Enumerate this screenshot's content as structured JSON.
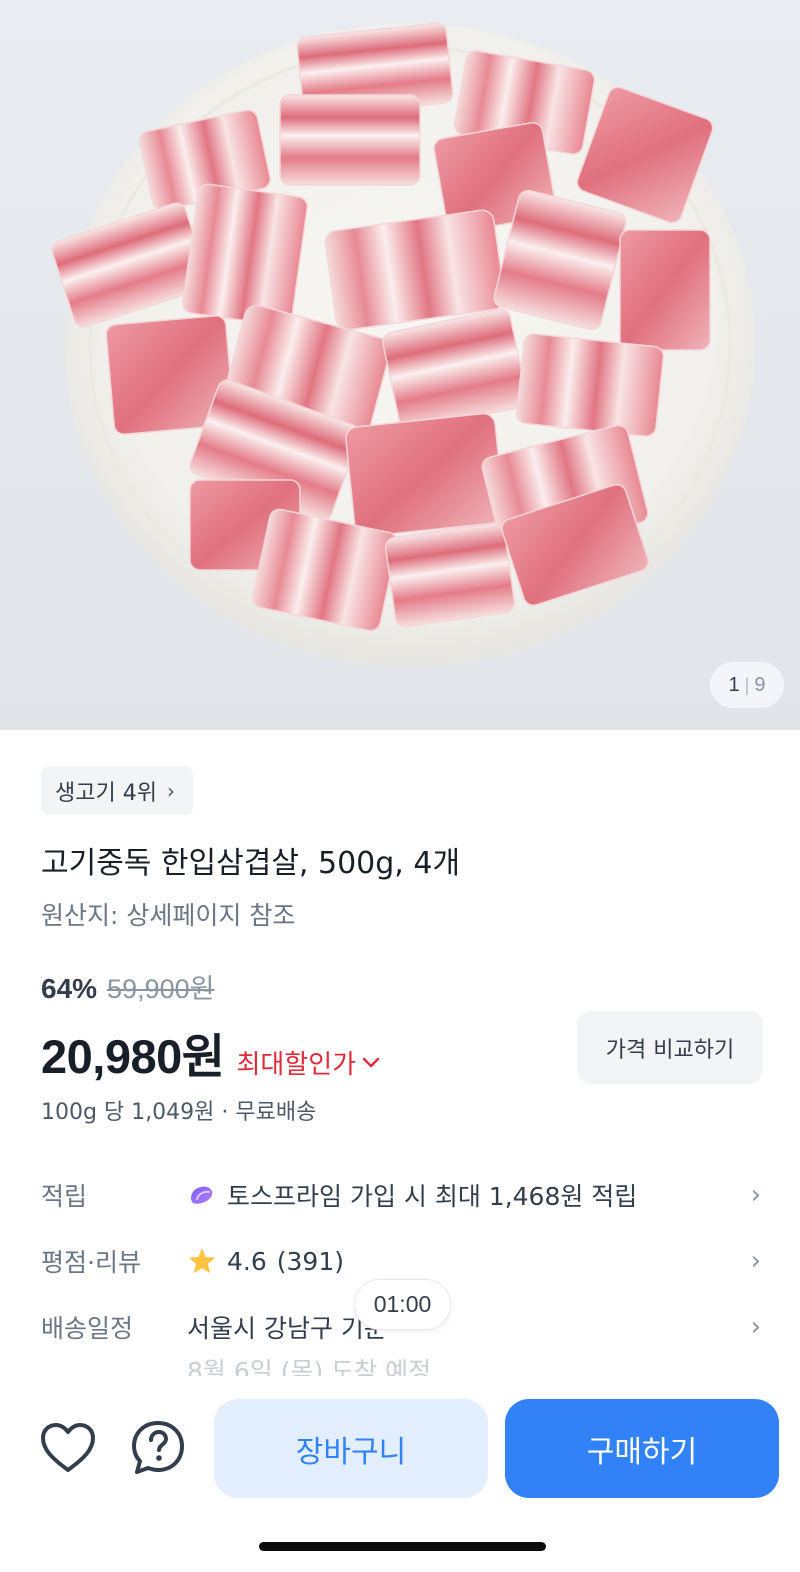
{
  "hero": {
    "image_alt": "한입삼겹살",
    "counter_current": "1",
    "counter_total": "9"
  },
  "product": {
    "rank_chip": "생고기 4위",
    "title": "고기중독 한입삼겹살, 500g, 4개",
    "origin": "원산지: 상세페이지 참조",
    "discount_rate": "64%",
    "original_price": "59,900원",
    "price": "20,980원",
    "max_discount_label": "최대할인가",
    "compare_button": "가격 비교하기",
    "unit_price": "100g 당 1,049원 · 무료배송"
  },
  "info_rows": {
    "points": {
      "label": "적립",
      "value": "토스프라임 가입 시 최대 1,468원 적립"
    },
    "review": {
      "label": "평점·리뷰",
      "rating": "4.6",
      "count": "(391)"
    },
    "delivery": {
      "label": "배송일정",
      "value": "서울시 강남구 기준",
      "sub": "8월 6일 (목) 도착 예정"
    }
  },
  "timer": "01:00",
  "bottom_bar": {
    "cart_label": "장바구니",
    "buy_label": "구매하기"
  },
  "colors": {
    "accent": "#3182f6",
    "accent_light": "#e3eeff",
    "discount_red": "#e42939",
    "star": "#ffc342"
  },
  "icons": {
    "heart": "heart-icon",
    "help": "question-chat-icon",
    "star": "star-icon",
    "prime": "toss-prime-icon",
    "chevron_right": "chevron-right-icon",
    "chevron_down": "chevron-down-icon"
  }
}
